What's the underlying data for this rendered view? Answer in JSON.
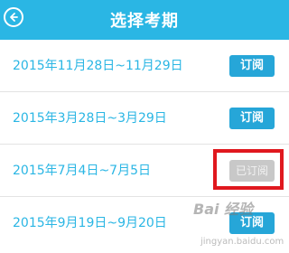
{
  "header": {
    "title": "选择考期",
    "back_icon": "back-arrow-icon",
    "color": "#2ab6e4"
  },
  "periods": [
    {
      "date": "2015年11月28日~11月29日",
      "button": "订阅",
      "status": "available"
    },
    {
      "date": "2015年3月28日~3月29日",
      "button": "订阅",
      "status": "available"
    },
    {
      "date": "2015年7月4日~7月5日",
      "button": "已订阅",
      "status": "subscribed"
    },
    {
      "date": "2015年9月19日~9月20日",
      "button": "订阅",
      "status": "available"
    }
  ],
  "annotation": {
    "color": "#e0181e"
  },
  "watermark": {
    "text": "Bai 经验",
    "sub": "jingyan.baidu.com"
  },
  "colors": {
    "accent": "#2ab6e4",
    "button": "#26a6d8",
    "disabled_button": "#c8c8c8"
  }
}
